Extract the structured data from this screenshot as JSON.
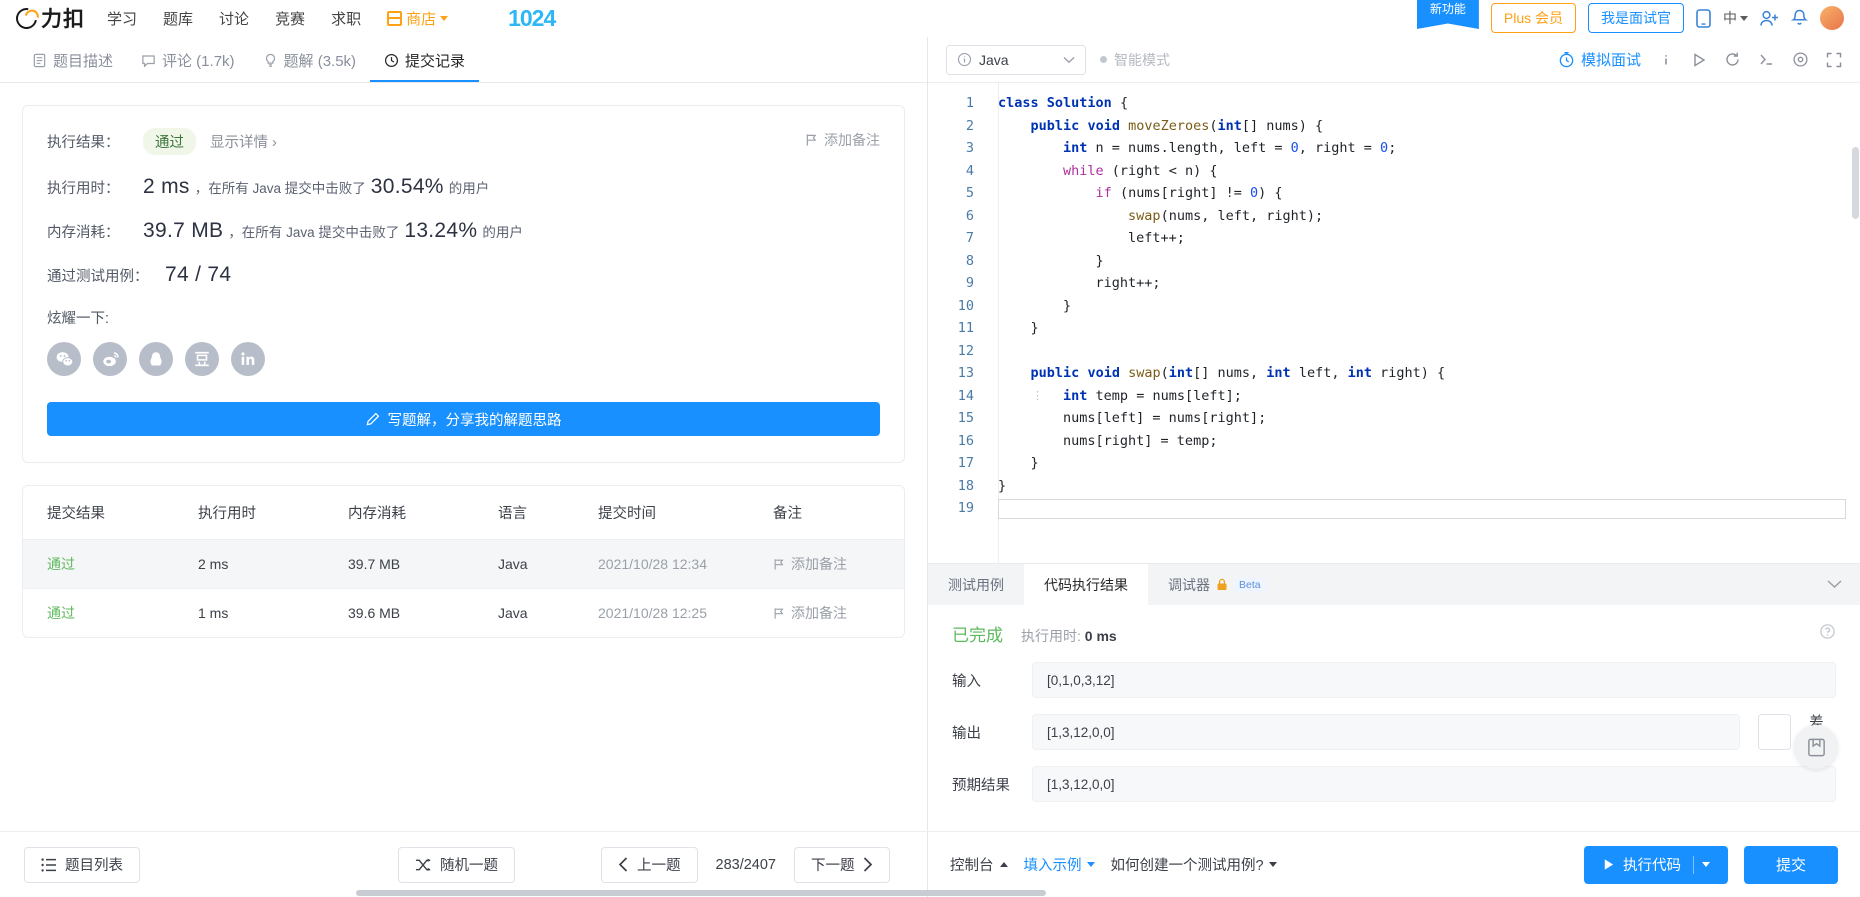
{
  "topnav": {
    "logo_text": "力扣",
    "items": [
      {
        "label": "学习"
      },
      {
        "label": "题库"
      },
      {
        "label": "讨论"
      },
      {
        "label": "竞赛"
      },
      {
        "label": "求职"
      },
      {
        "label": "商店"
      }
    ],
    "brand_1024": "1024",
    "new_feature_badge": "新功能",
    "plus_label": "Plus 会员",
    "interviewer_label": "我是面试官",
    "lang_label": "中",
    "icons": {
      "mobile": "mobile-icon",
      "language": "language-globe-icon",
      "invite": "add-friend-icon",
      "bell": "notification-bell-icon",
      "avatar": "user-avatar"
    }
  },
  "left_tabs": [
    {
      "label": "题目描述",
      "icon": "document-icon",
      "active": false
    },
    {
      "label": "评论 (1.7k)",
      "icon": "comment-icon",
      "active": false
    },
    {
      "label": "题解 (3.5k)",
      "icon": "bulb-icon",
      "active": false
    },
    {
      "label": "提交记录",
      "icon": "clock-icon",
      "active": true
    }
  ],
  "result": {
    "add_note": "添加备注",
    "exec_result_label": "执行结果：",
    "status": "通过",
    "show_detail": "显示详情 ›",
    "runtime_label": "执行用时：",
    "runtime_value": "2 ms",
    "runtime_mid": "，在所有 Java 提交中击败了",
    "runtime_percent": "30.54%",
    "runtime_tail": "的用户",
    "memory_label": "内存消耗：",
    "memory_value": "39.7 MB",
    "memory_mid": "，在所有 Java 提交中击败了",
    "memory_percent": "13.24%",
    "memory_tail": "的用户",
    "testcase_label": "通过测试用例：",
    "testcase_value": "74 / 74",
    "share_label": "炫耀一下:",
    "share_icons": [
      "wechat-icon",
      "weibo-icon",
      "qq-icon",
      "douban-icon",
      "linkedin-icon"
    ],
    "cta_label": "写题解，分享我的解题思路",
    "cta_icon": "pencil-icon"
  },
  "table": {
    "headers": [
      "提交结果",
      "执行用时",
      "内存消耗",
      "语言",
      "提交时间",
      "备注"
    ],
    "rows": [
      {
        "result": "通过",
        "runtime": "2 ms",
        "memory": "39.7 MB",
        "lang": "Java",
        "time": "2021/10/28 12:34",
        "note": "添加备注"
      },
      {
        "result": "通过",
        "runtime": "1 ms",
        "memory": "39.6 MB",
        "lang": "Java",
        "time": "2021/10/28 12:25",
        "note": "添加备注"
      }
    ]
  },
  "editor": {
    "language": "Java",
    "smart_mode": "智能模式",
    "mock_interview": "模拟面试",
    "icons": [
      "info-icon",
      "run-play-icon",
      "reset-icon",
      "console-icon",
      "settings-icon",
      "fullscreen-icon"
    ],
    "line_numbers": [
      "1",
      "2",
      "3",
      "4",
      "5",
      "6",
      "7",
      "8",
      "9",
      "10",
      "11",
      "12",
      "13",
      "14",
      "15",
      "16",
      "17",
      "18",
      "19"
    ],
    "code_lines": [
      "class Solution {",
      "    public void moveZeroes(int[] nums) {",
      "        int n = nums.length, left = 0, right = 0;",
      "        while (right < n) {",
      "            if (nums[right] != 0) {",
      "                swap(nums, left, right);",
      "                left++;",
      "            }",
      "            right++;",
      "        }",
      "    }",
      "",
      "    public void swap(int[] nums, int left, int right) {",
      "        int temp = nums[left];",
      "        nums[left] = nums[right];",
      "        nums[right] = temp;",
      "    }",
      "}",
      ""
    ]
  },
  "bottom_panel": {
    "tabs": [
      {
        "label": "测试用例",
        "active": false
      },
      {
        "label": "代码执行结果",
        "active": true
      },
      {
        "label": "调试器",
        "active": false,
        "badge": "Beta",
        "lock": "lock-icon"
      }
    ],
    "status": "已完成",
    "elapsed_label": "执行用时:",
    "elapsed_value": "0 ms",
    "input_label": "输入",
    "input_value": "[0,1,0,3,12]",
    "output_label": "输出",
    "output_value": "[1,3,12,0,0]",
    "expected_label": "预期结果",
    "expected_value": "[1,3,12,0,0]",
    "diff_label": "差别"
  },
  "footer": {
    "problem_list": "题目列表",
    "random": "随机一题",
    "prev": "上一题",
    "page": "283/2407",
    "next": "下一题",
    "console": "控制台",
    "fill_example": "填入示例",
    "how_to": "如何创建一个测试用例?",
    "run_code": "执行代码",
    "submit": "提交"
  },
  "colors": {
    "accent_blue": "#1890ff",
    "accent_orange": "#ffa116",
    "pass_green": "#5eb95e",
    "text_dark": "#3c4049"
  }
}
